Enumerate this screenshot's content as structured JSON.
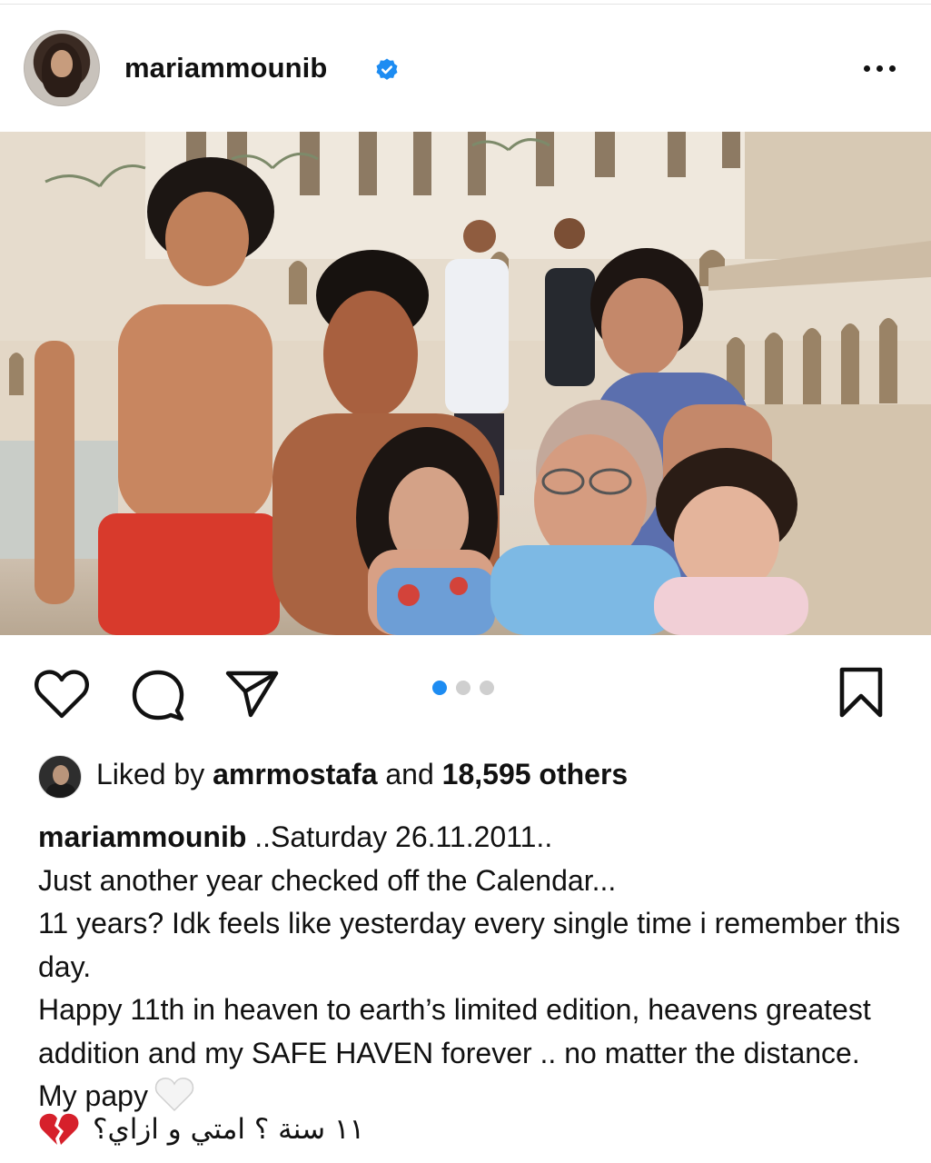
{
  "post": {
    "username": "mariammounib",
    "verified": true,
    "icons": {
      "verified": "verified-badge-icon",
      "more": "more-options-icon",
      "like": "heart-icon",
      "comment": "comment-bubble-icon",
      "share": "paper-plane-icon",
      "save": "bookmark-icon"
    },
    "carousel": {
      "count": 3,
      "active_index": 1
    },
    "likes": {
      "prefix": "Liked by",
      "liker": "amrmostafa",
      "connector": "and",
      "others": "18,595 others"
    },
    "caption": {
      "author": "mariammounib",
      "first_line": "..Saturday 26.11.2011..",
      "line2": "Just another year checked off the Calendar...",
      "line3": "11 years? Idk feels like yesterday every single time i remember this day.",
      "line4": "Happy 11th in heaven to earth’s limited edition, heavens greatest addition and my SAFE HAVEN forever .. no matter the distance. My papy",
      "line4_emoji": "white-heart-emoji",
      "arabic": "١١ سنة ؟ امتي و ازاي؟",
      "arabic_emoji": "broken-heart-emoji"
    },
    "colors": {
      "accent": "#1d8cf2",
      "text": "#111111",
      "carousel_inactive": "#cfcfcf",
      "broken_heart": "#d6202b"
    }
  }
}
